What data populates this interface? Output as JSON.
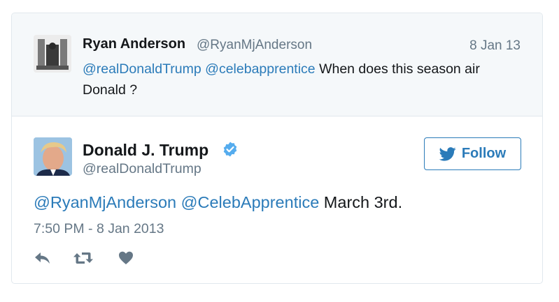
{
  "quoted_tweet": {
    "name": "Ryan Anderson",
    "handle": "@RyanMjAnderson",
    "date": "8 Jan 13",
    "mention_1": "@realDonaldTrump",
    "mention_2": "@celebapprentice",
    "text": "When does this season air Donald ?"
  },
  "main_tweet": {
    "name": "Donald J. Trump",
    "handle": "@realDonaldTrump",
    "verified_icon": "verified-badge-icon",
    "mention_1": "@RyanMjAnderson",
    "mention_2": "@CelebApprentice",
    "text": "March 3rd.",
    "timestamp": "7:50 PM - 8 Jan 2013"
  },
  "follow_button": {
    "label": "Follow",
    "icon": "twitter-bird-icon"
  },
  "actions": [
    "reply-icon",
    "retweet-icon",
    "like-heart-icon"
  ],
  "colors": {
    "link": "#2b7bb9",
    "secondary_text": "#657786",
    "quoted_bg": "#f5f8fa",
    "border": "#e1e8ed",
    "action_icon": "#657786"
  }
}
